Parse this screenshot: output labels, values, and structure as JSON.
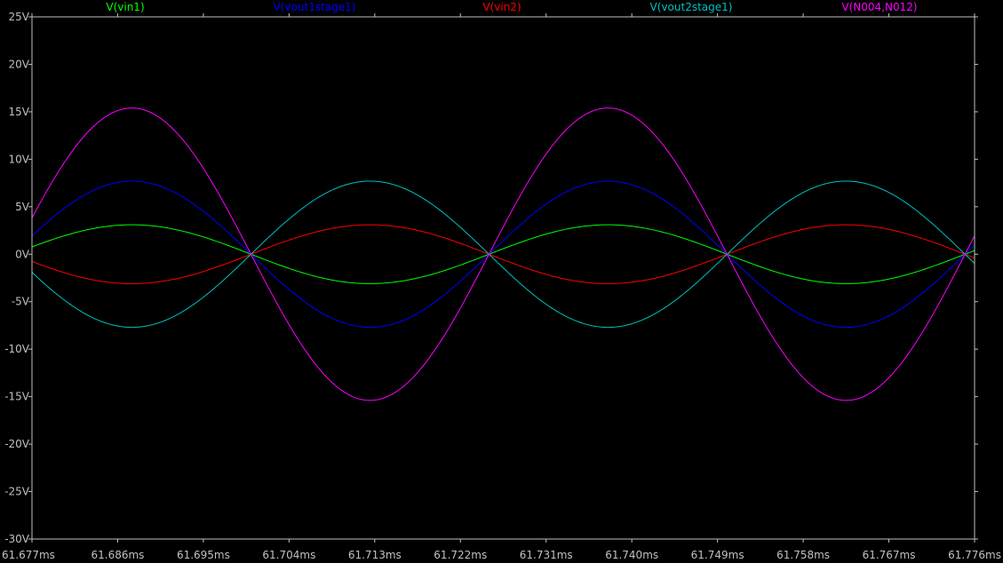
{
  "chart_data": {
    "type": "line",
    "title": "",
    "xlabel": "",
    "ylabel": "",
    "x_unit": "ms",
    "y_unit": "V",
    "xlim": [
      61.677,
      61.776
    ],
    "ylim": [
      -30,
      25
    ],
    "xticks": [
      "61.677ms",
      "61.686ms",
      "61.695ms",
      "61.704ms",
      "61.713ms",
      "61.722ms",
      "61.731ms",
      "61.740ms",
      "61.749ms",
      "61.758ms",
      "61.767ms",
      "61.776ms"
    ],
    "xtick_values": [
      61.677,
      61.686,
      61.695,
      61.704,
      61.713,
      61.722,
      61.731,
      61.74,
      61.749,
      61.758,
      61.767,
      61.776
    ],
    "yticks": [
      "25V",
      "20V",
      "15V",
      "10V",
      "5V",
      "0V",
      "-5V",
      "-10V",
      "-15V",
      "-20V",
      "-25V",
      "-30V"
    ],
    "ytick_values": [
      25,
      20,
      15,
      10,
      5,
      0,
      -5,
      -10,
      -15,
      -20,
      -25,
      -30
    ],
    "grid": false,
    "legend_placement": "top",
    "period_ms": 0.05,
    "series": [
      {
        "name": "V(vin1)",
        "color": "#00ff00",
        "amplitude": 3.1,
        "phase_deg": 180,
        "zero_cross_ms": 61.7
      },
      {
        "name": "V(vout1stage1)",
        "color": "#0000ff",
        "amplitude": 7.7,
        "phase_deg": 180,
        "zero_cross_ms": 61.7
      },
      {
        "name": "V(vin2)",
        "color": "#ff0000",
        "amplitude": 3.1,
        "phase_deg": 0,
        "zero_cross_ms": 61.7
      },
      {
        "name": "V(vout2stage1)",
        "color": "#00c0c0",
        "amplitude": 7.7,
        "phase_deg": 0,
        "zero_cross_ms": 61.7
      },
      {
        "name": "V(N004,N012)",
        "color": "#ff00ff",
        "amplitude": 15.4,
        "phase_deg": 180,
        "zero_cross_ms": 61.7
      }
    ]
  }
}
